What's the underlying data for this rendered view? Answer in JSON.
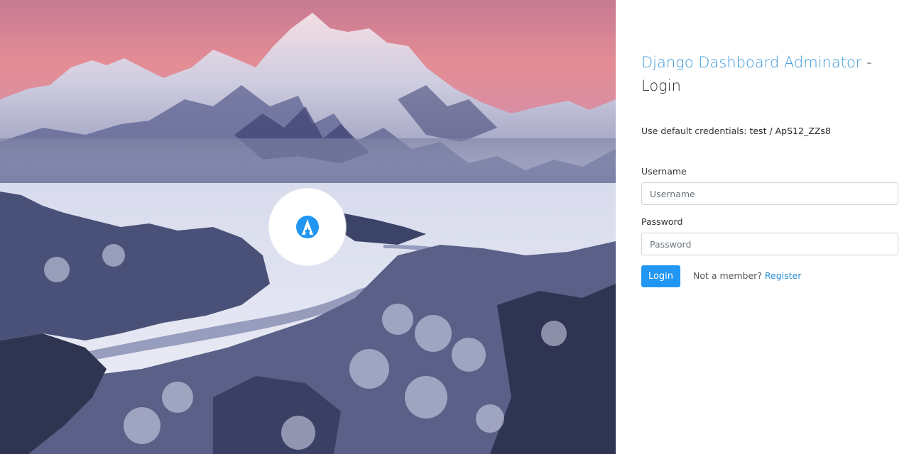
{
  "hero": {
    "image": "snowy-mountain-valley-photo",
    "logo_icon": "adminator-logo-icon"
  },
  "login": {
    "title_brand": "Django Dashboard Adminator",
    "title_separator": " - ",
    "title_suffix": "Login",
    "credentials_prefix": "Use default credentials: ",
    "credentials_value": "test / ApS12_ZZs8",
    "username_label": "Username",
    "username_placeholder": "Username",
    "username_value": "",
    "password_label": "Password",
    "password_placeholder": "Password",
    "password_value": "",
    "login_button": "Login",
    "member_text": "Not a member? ",
    "register_link": "Register"
  },
  "colors": {
    "accent": "#2196f3",
    "brand_text": "#3a9ad9",
    "link": "#2a8fd6"
  }
}
